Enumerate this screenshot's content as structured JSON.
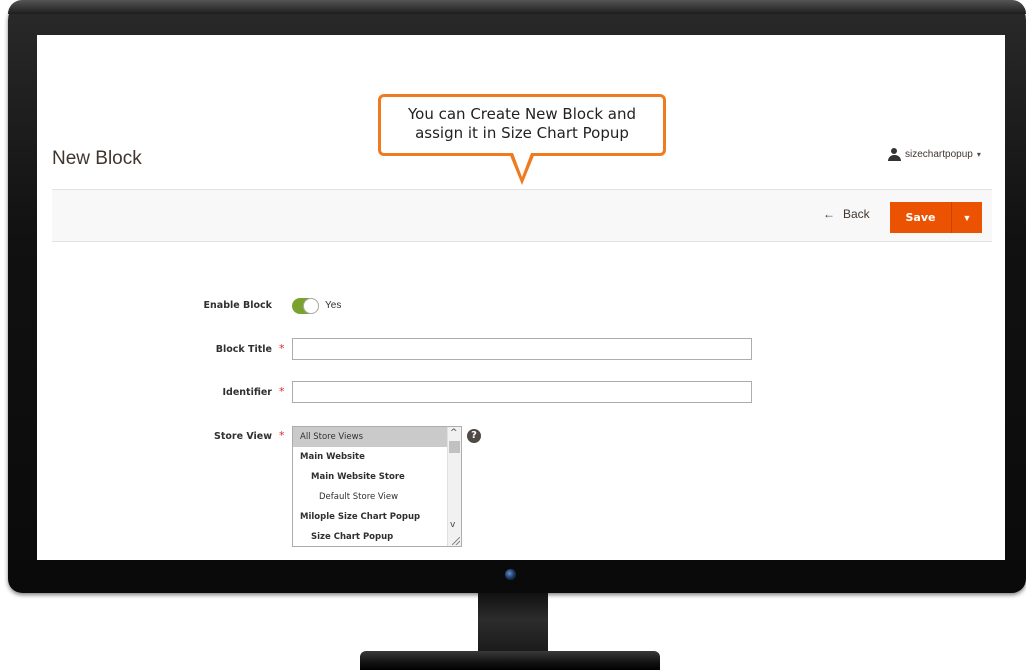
{
  "page": {
    "title": "New Block",
    "user_name": "sizechartpopup"
  },
  "toolbar": {
    "back_label": "Back",
    "save_label": "Save"
  },
  "callout": {
    "line1": "You can Create New Block and",
    "line2": "assign it in Size Chart Popup"
  },
  "form": {
    "enable_block": {
      "label": "Enable Block",
      "value": "Yes",
      "enabled": true
    },
    "block_title": {
      "label": "Block Title",
      "value": "",
      "required": true
    },
    "identifier": {
      "label": "Identifier",
      "value": "",
      "required": true
    },
    "store_view": {
      "label": "Store View",
      "required": true,
      "options": [
        {
          "label": "All Store Views",
          "selected": true
        },
        {
          "label": "Main Website"
        },
        {
          "label": "Main Website Store"
        },
        {
          "label": "Default Store View"
        },
        {
          "label": "Milople Size Chart Popup"
        },
        {
          "label": "Size Chart Popup"
        }
      ],
      "help": "?"
    }
  },
  "colors": {
    "accent": "#eb5202",
    "toggle_on": "#79a22e",
    "callout_border": "#ef7b21",
    "required": "#e22626"
  },
  "icons": [
    "user-icon",
    "back-arrow-icon",
    "caret-down-icon",
    "help-icon",
    "scroll-up-icon",
    "scroll-down-icon",
    "resize-grip-icon"
  ]
}
